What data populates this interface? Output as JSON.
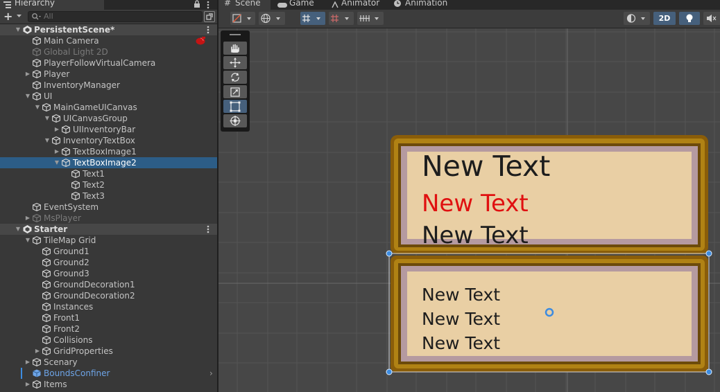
{
  "hierarchy": {
    "tab_label": "Hierarchy",
    "search_placeholder": "All",
    "add_label": "+",
    "rows": [
      {
        "label": "PersistentScene*",
        "kind": "scene",
        "depth": 0,
        "expanded": true
      },
      {
        "label": "Main Camera",
        "kind": "go",
        "depth": 1
      },
      {
        "label": "Global Light 2D",
        "kind": "go",
        "depth": 1,
        "dim": true
      },
      {
        "label": "PlayerFollowVirtualCamera",
        "kind": "go",
        "depth": 1
      },
      {
        "label": "Player",
        "kind": "go",
        "depth": 1,
        "collapsed": true
      },
      {
        "label": "InventoryManager",
        "kind": "go",
        "depth": 1
      },
      {
        "label": "UI",
        "kind": "go",
        "depth": 1,
        "expanded": true
      },
      {
        "label": "MainGameUICanvas",
        "kind": "go",
        "depth": 2,
        "expanded": true
      },
      {
        "label": "UICanvasGroup",
        "kind": "go",
        "depth": 3,
        "expanded": true
      },
      {
        "label": "UIInventoryBar",
        "kind": "go",
        "depth": 4,
        "collapsed": true
      },
      {
        "label": "InventoryTextBox",
        "kind": "go",
        "depth": 3,
        "expanded": true
      },
      {
        "label": "TextBoxImage1",
        "kind": "go",
        "depth": 4,
        "collapsed": true
      },
      {
        "label": "TextBoxImage2",
        "kind": "go",
        "depth": 4,
        "expanded": true,
        "selected": true
      },
      {
        "label": "Text1",
        "kind": "go",
        "depth": 5
      },
      {
        "label": "Text2",
        "kind": "go",
        "depth": 5
      },
      {
        "label": "Text3",
        "kind": "go",
        "depth": 5
      },
      {
        "label": "EventSystem",
        "kind": "go",
        "depth": 1
      },
      {
        "label": "MsPlayer",
        "kind": "go",
        "depth": 1,
        "collapsed": true,
        "dim": true
      },
      {
        "label": "Starter",
        "kind": "scene",
        "depth": 0,
        "expanded": true
      },
      {
        "label": "TileMap Grid",
        "kind": "go",
        "depth": 1,
        "expanded": true
      },
      {
        "label": "Ground1",
        "kind": "go",
        "depth": 2
      },
      {
        "label": "Ground2",
        "kind": "go",
        "depth": 2
      },
      {
        "label": "Ground3",
        "kind": "go",
        "depth": 2
      },
      {
        "label": "GroundDecoration1",
        "kind": "go",
        "depth": 2
      },
      {
        "label": "GroundDecoration2",
        "kind": "go",
        "depth": 2
      },
      {
        "label": "Instances",
        "kind": "go",
        "depth": 2
      },
      {
        "label": "Front1",
        "kind": "go",
        "depth": 2
      },
      {
        "label": "Front2",
        "kind": "go",
        "depth": 2
      },
      {
        "label": "Collisions",
        "kind": "go",
        "depth": 2
      },
      {
        "label": "GridProperties",
        "kind": "go",
        "depth": 2,
        "collapsed": true
      },
      {
        "label": "Scenary",
        "kind": "go",
        "depth": 1,
        "collapsed": true
      },
      {
        "label": "BoundsConfiner",
        "kind": "go",
        "depth": 1,
        "blue": true
      },
      {
        "label": "Items",
        "kind": "go",
        "depth": 1,
        "collapsed": true
      }
    ]
  },
  "scene_tabs": {
    "scene": "Scene",
    "game": "Game",
    "animator": "Animator",
    "animation": "Animation"
  },
  "scene_toolbar": {
    "mode_2d": "2D"
  },
  "textbox1": {
    "line1": "New Text",
    "line2": "New Text",
    "line3": "New Text",
    "line2_color": "#e01010"
  },
  "textbox2": {
    "line1": "New Text",
    "line2": "New Text",
    "line3": "New Text"
  },
  "colors": {
    "selection": "#2c5d87",
    "frame_brown": "#7a5207",
    "frame_gold": "#a87b11",
    "inner_mauve": "#b59aa0",
    "paper": "#e9cfa4",
    "grid_line": "#545454"
  }
}
